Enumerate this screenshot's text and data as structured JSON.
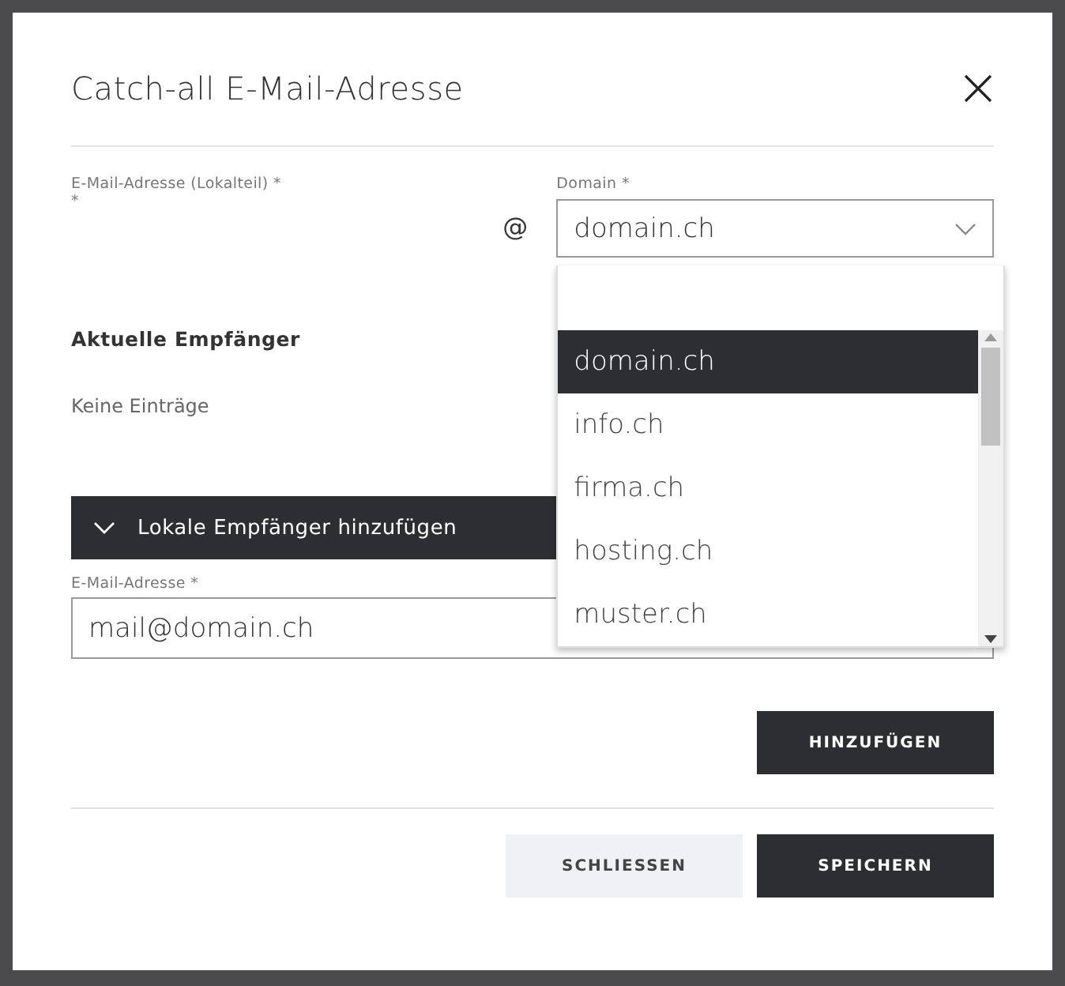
{
  "dialog": {
    "title": "Catch-all E-Mail-Adresse"
  },
  "local_part": {
    "label": "E-Mail-Adresse (Lokalteil)",
    "required_mark": "*",
    "error_mark": "*"
  },
  "at_sign": "@",
  "domain": {
    "label": "Domain",
    "required_mark": "*",
    "value": "domain.ch",
    "expanded": true,
    "options": [
      {
        "label": "domain.ch",
        "selected": true
      },
      {
        "label": "info.ch",
        "selected": false
      },
      {
        "label": "firma.ch",
        "selected": false
      },
      {
        "label": "hosting.ch",
        "selected": false
      },
      {
        "label": "muster.ch",
        "selected": false
      }
    ]
  },
  "current_recipients": {
    "heading": "Aktuelle Empfänger",
    "empty_text": "Keine Einträge"
  },
  "local_recipients": {
    "toggle": "Lokale Empfänger hinzufügen",
    "expanded": true,
    "email_label": "E-Mail-Adresse",
    "required_mark": "*",
    "email_value": "mail@domain.ch",
    "add_button": "HINZUFÜGEN"
  },
  "buttons": [
    {
      "label": "SCHLIESSEN",
      "kind": "secondary"
    },
    {
      "label": "SPEICHERN",
      "kind": "primary"
    }
  ]
}
